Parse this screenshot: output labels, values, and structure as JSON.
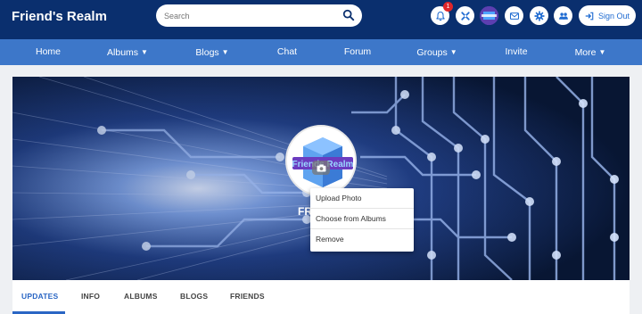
{
  "header": {
    "brand": "Friend's Realm",
    "search_placeholder": "Search",
    "notification_count": "1",
    "signout_label": "Sign Out",
    "colors": {
      "header_bg": "#0a2f6e",
      "nav_bg": "#3d77c9",
      "accent": "#1f6bd1",
      "badge": "#e0262a"
    }
  },
  "nav": {
    "items": [
      {
        "label": "Home"
      },
      {
        "label": "Albums"
      },
      {
        "label": "Blogs"
      },
      {
        "label": "Chat"
      },
      {
        "label": "Forum"
      },
      {
        "label": "Groups"
      },
      {
        "label": "Invite"
      },
      {
        "label": "More"
      }
    ]
  },
  "cover": {
    "profile_name_visible": "FR",
    "logo_text": "Friends Realm",
    "photo_menu": {
      "items": [
        {
          "label": "Upload Photo"
        },
        {
          "label": "Choose from Albums"
        },
        {
          "label": "Remove"
        }
      ]
    }
  },
  "tabs": {
    "items": [
      {
        "label": "UPDATES"
      },
      {
        "label": "INFO"
      },
      {
        "label": "ALBUMS"
      },
      {
        "label": "BLOGS"
      },
      {
        "label": "FRIENDS"
      }
    ],
    "active_index": 0
  },
  "icons": {
    "header": [
      "bell-icon",
      "tools-icon",
      "user-avatar",
      "mail-icon",
      "gear-icon",
      "users-icon",
      "sign-out-icon"
    ],
    "search": "search-icon",
    "camera": "camera-icon"
  }
}
